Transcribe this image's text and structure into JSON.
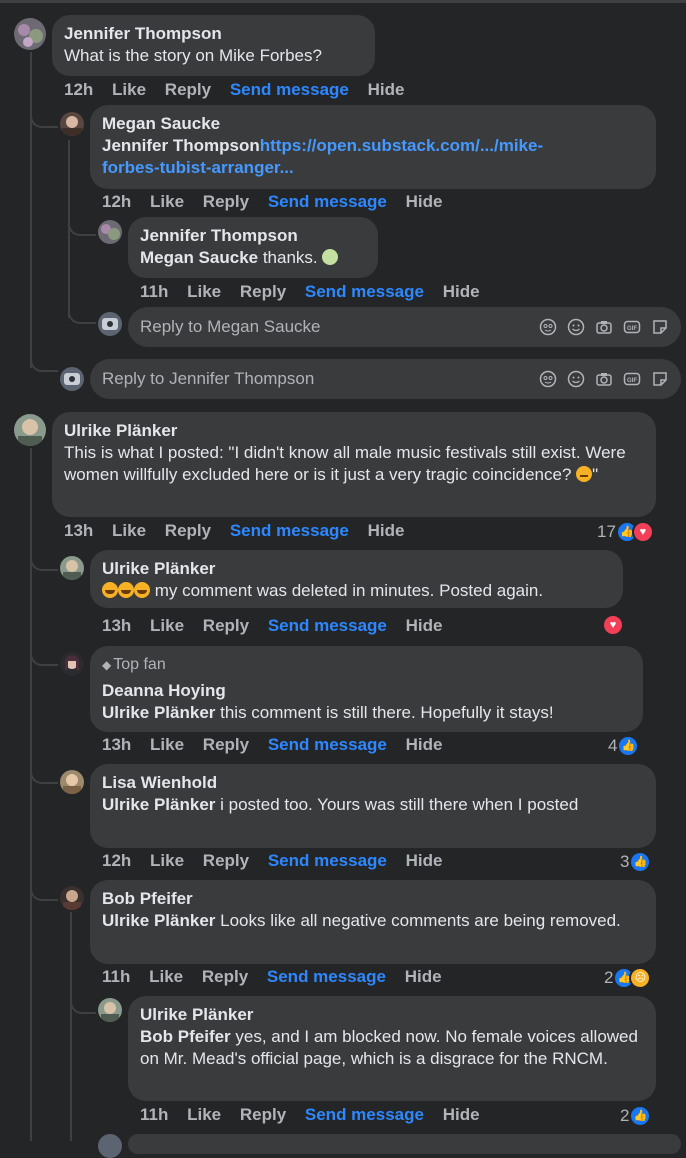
{
  "actions": {
    "like": "Like",
    "reply": "Reply",
    "send": "Send message",
    "hide": "Hide"
  },
  "comments": [
    {
      "author": "Jennifer Thompson",
      "text": "What is the story on Mike Forbes?",
      "time": "12h"
    },
    {
      "author": "Megan Saucke",
      "tag": "Jennifer Thompson",
      "link": "https://open.substack.com/.../mike-forbes-tubist-arranger...",
      "link_line1": "https://open.substack.com/.../mike-",
      "link_line2": "forbes-tubist-arranger...",
      "time": "12h"
    },
    {
      "author": "Jennifer Thompson",
      "tag": "Megan Saucke",
      "text": " thanks.",
      "emoji": "cold-face",
      "time": "11h"
    },
    {
      "author": "Ulrike Plänker",
      "text": "This is what I posted: \"I didn't know all male music festivals still exist. Were women willfully excluded here or is it just a very tragic coincidence? ",
      "text_end": "\"",
      "emoji": "neutral-face",
      "time": "13h",
      "reactions": "17"
    },
    {
      "author": "Ulrike Plänker",
      "text": " my comment was deleted in minutes. Posted again.",
      "emoji": "laughing-faces",
      "time": "13h"
    },
    {
      "badge": "Top fan",
      "author": "Deanna Hoying",
      "tag": "Ulrike Plänker",
      "text": " this comment is still there. Hopefully it stays!",
      "time": "13h",
      "reactions": "4"
    },
    {
      "author": "Lisa Wienhold",
      "tag": "Ulrike Plänker",
      "text": " i posted too. Yours was still there when I posted",
      "time": "12h",
      "reactions": "3"
    },
    {
      "author": "Bob Pfeifer",
      "tag": "Ulrike Plänker",
      "text": " Looks like all negative comments are being removed.",
      "time": "11h",
      "reactions": "2"
    },
    {
      "author": "Ulrike Plänker",
      "tag": "Bob Pfeifer",
      "text": " yes, and I am blocked now. No female voices allowed on Mr. Mead's official page, which is a disgrace for the RNCM.",
      "time": "11h",
      "reactions": "2"
    }
  ],
  "reply_boxes": [
    {
      "placeholder": "Reply to Megan Saucke"
    },
    {
      "placeholder": "Reply to Jennifer Thompson"
    }
  ],
  "icons": [
    "avatar-icon",
    "emoji-icon",
    "camera-icon",
    "gif-icon",
    "sticker-icon",
    "like-reaction-icon",
    "love-reaction-icon",
    "sad-reaction-icon"
  ],
  "colors": {
    "background": "#242526",
    "bubble": "#3a3b3c",
    "text": "#e4e6eb",
    "muted": "#b0b3b8",
    "link": "#2d88ff",
    "like": "#1877f2",
    "love": "#f33e58"
  }
}
